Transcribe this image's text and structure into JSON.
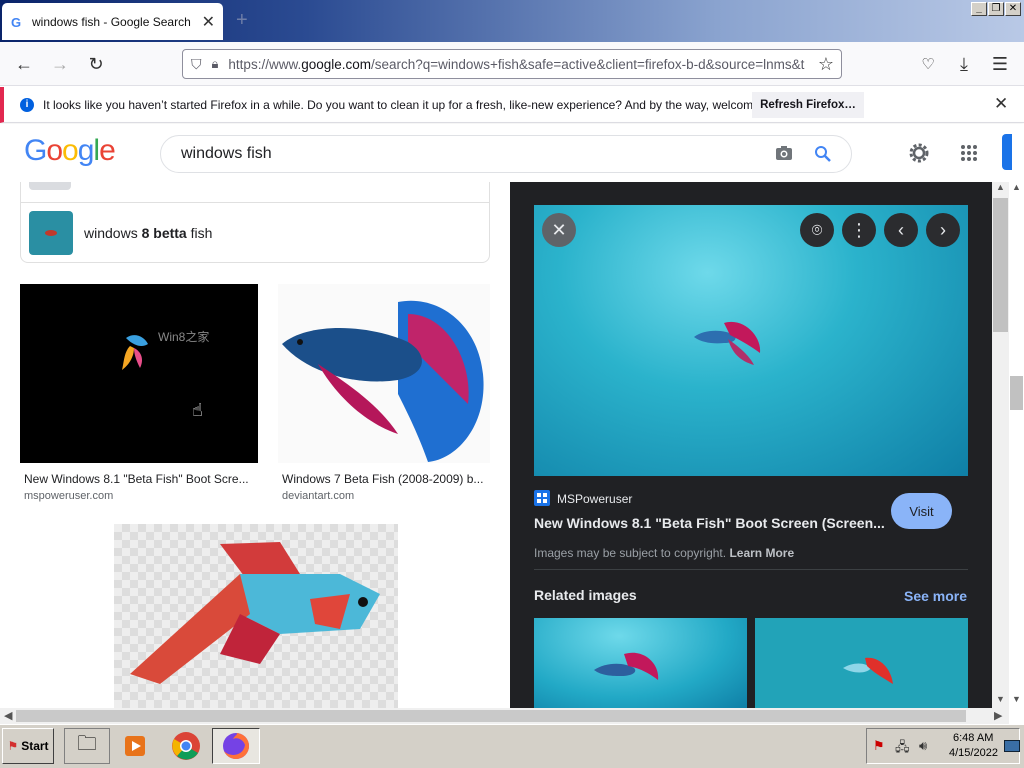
{
  "browser": {
    "tab_title": "windows fish - Google Search",
    "tab_close": "✕",
    "new_tab": "+",
    "url_prefix": "https://www.",
    "url_domain": "google.com",
    "url_rest": "/search?q=windows+fish&safe=active&client=firefox-b-d&source=lnms&t",
    "window_controls": [
      "_",
      "❐",
      "✕"
    ]
  },
  "notification": {
    "message": "It looks like you haven’t started Firefox in a while. Do you want to clean it up for a fresh, like-new experience? And by the way, welcome back!",
    "button": "Refresh Firefox…",
    "close": "✕"
  },
  "google": {
    "logo_letters": [
      "G",
      "o",
      "o",
      "g",
      "l",
      "e"
    ],
    "logo_colors": [
      "#4285f4",
      "#ea4335",
      "#fbbc05",
      "#4285f4",
      "#34a853",
      "#ea4335"
    ],
    "query": "windows fish"
  },
  "suggestion": {
    "pre": "windows ",
    "bold": "8 betta",
    "post": " fish"
  },
  "results": [
    {
      "caption": "New Windows 8.1 \"Beta Fish\" Boot Scre...",
      "source": "mspoweruser.com",
      "overlay": "Win8之家"
    },
    {
      "caption": "Windows 7 Beta Fish (2008-2009) b...",
      "source": "deviantart.com"
    }
  ],
  "panel": {
    "source_name": "MSPoweruser",
    "title": "New Windows 8.1 \"Beta Fish\" Boot Screen (Screen...",
    "visit": "Visit",
    "copyright": "Images may be subject to copyright.",
    "learn_more": "Learn More",
    "related": "Related images",
    "see_more": "See more"
  },
  "taskbar": {
    "start": "Start",
    "time": "6:48 AM",
    "date": "4/15/2022"
  }
}
